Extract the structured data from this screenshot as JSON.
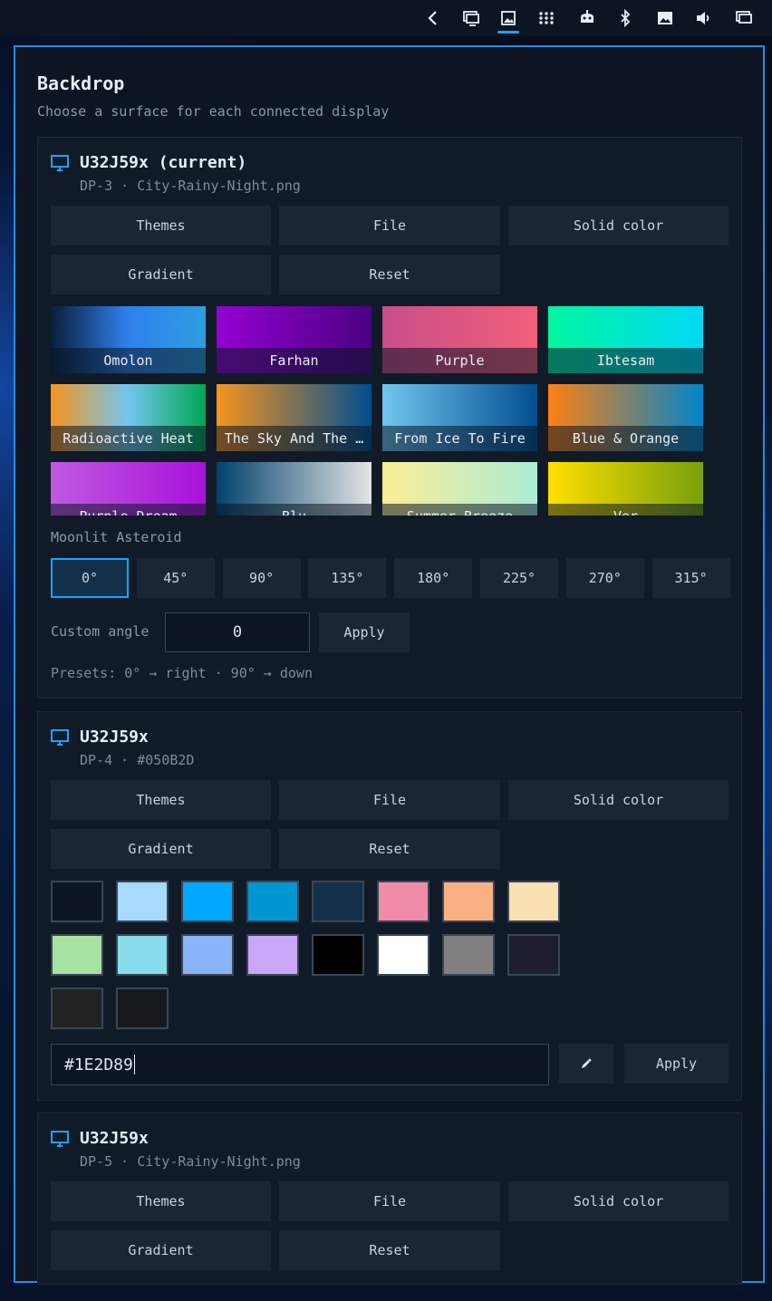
{
  "panel": {
    "title": "Backdrop",
    "subtitle": "Choose a surface for each connected display"
  },
  "topbar": {
    "icons": [
      "chevron-left-icon",
      "display-icon",
      "wallpaper-icon",
      "apps-grid-icon",
      "robot-icon",
      "bluetooth-icon",
      "image-icon",
      "volume-icon",
      "monitor-icon"
    ]
  },
  "displays": [
    {
      "name": "U32J59x (current)",
      "sub": "DP-3 · City-Rainy-Night.png",
      "buttons": [
        "Themes",
        "File",
        "Solid color",
        "Gradient",
        "Reset"
      ],
      "themes": [
        {
          "label": "Omolon",
          "colors": [
            "#091e3a",
            "#2f80ed",
            "#2d9ee0"
          ]
        },
        {
          "label": "Farhan",
          "colors": [
            "#9400d3",
            "#4b0082"
          ]
        },
        {
          "label": "Purple",
          "colors": [
            "#c84e89",
            "#f15f79"
          ]
        },
        {
          "label": "Ibtesam",
          "colors": [
            "#00f5a0",
            "#00d9f5"
          ]
        },
        {
          "label": "Radioactive Heat",
          "colors": [
            "#f7941e",
            "#72c6ef",
            "#00a651"
          ]
        },
        {
          "label": "The Sky And The …",
          "colors": [
            "#f7941e",
            "#004e8f"
          ]
        },
        {
          "label": "From Ice To Fire",
          "colors": [
            "#72c6ef",
            "#004e8f"
          ]
        },
        {
          "label": "Blue & Orange",
          "colors": [
            "#fd8112",
            "#0085ca"
          ]
        },
        {
          "label": "Purple Dream",
          "colors": [
            "#bf5ae0",
            "#a811da"
          ]
        },
        {
          "label": "Blu",
          "colors": [
            "#00416a",
            "#e4e5e6"
          ]
        },
        {
          "label": "Summer Breeze",
          "colors": [
            "#fbed96",
            "#abecd6"
          ]
        },
        {
          "label": "Ver",
          "colors": [
            "#ffe000",
            "#799f0c"
          ]
        }
      ],
      "gradient_name": "Moonlit Asteroid",
      "angles": [
        "0°",
        "45°",
        "90°",
        "135°",
        "180°",
        "225°",
        "270°",
        "315°"
      ],
      "active_angle": "0°",
      "custom_angle_label": "Custom angle",
      "custom_angle_value": "0",
      "apply_label": "Apply",
      "presets_hint": "Presets: 0° → right · 90° → down"
    },
    {
      "name": "U32J59x",
      "sub": "DP-4 · #050B2D",
      "buttons": [
        "Themes",
        "File",
        "Solid color",
        "Gradient",
        "Reset"
      ],
      "swatches": [
        "#0d1522",
        "#a6daff",
        "#00a8ff",
        "#0096d1",
        "#13304a",
        "#f08ca8",
        "#f9b184",
        "#f8e0b0",
        "#a6e3a1",
        "#89dceb",
        "#89b4fa",
        "#cba6f7",
        "#000000",
        "#ffffff",
        "#808080",
        "#1e1e2e",
        "#222222",
        "#16181d"
      ],
      "hex_value": "#1E2D89",
      "apply_label": "Apply"
    },
    {
      "name": "U32J59x",
      "sub": "DP-5 · City-Rainy-Night.png",
      "buttons": [
        "Themes",
        "File",
        "Solid color",
        "Gradient",
        "Reset"
      ]
    }
  ],
  "colors": {
    "accent": "#1aa3ff",
    "panel_bg": "#0d1522",
    "section_bg": "#111b28",
    "button_bg": "#1b2533"
  }
}
